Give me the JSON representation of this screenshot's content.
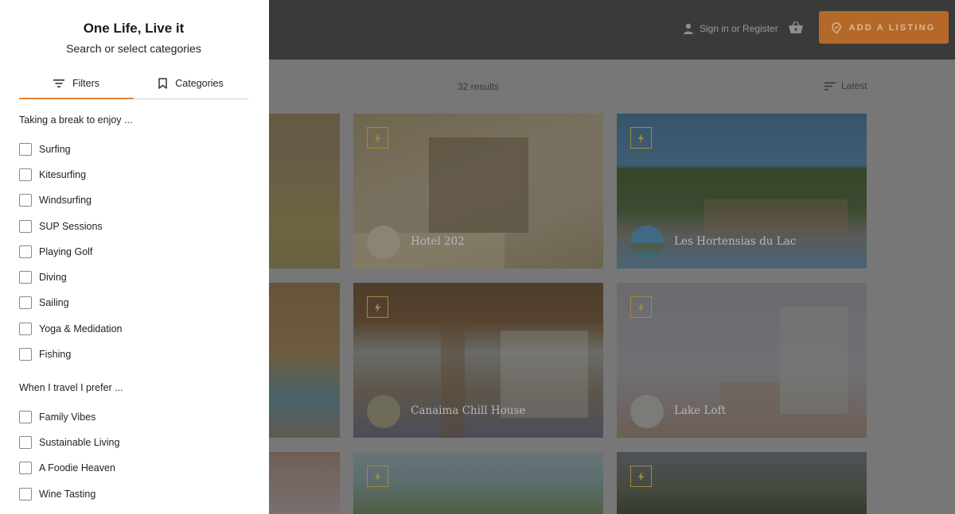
{
  "header": {
    "signin_label": "Sign in or Register",
    "add_listing_label": "ADD A LISTING"
  },
  "listing_bar": {
    "results_text": "32 results",
    "sort_label": "Latest"
  },
  "listings": [
    {
      "title": "Hotel 202"
    },
    {
      "title": "Les Hortensias du Lac"
    },
    {
      "title": "Canaima Chill House"
    },
    {
      "title": "Lake Loft"
    }
  ],
  "drawer": {
    "title": "One Life, Live it",
    "subtitle": "Search or select categories",
    "tabs": [
      {
        "label": "Filters",
        "icon": "filter-lines-icon",
        "active": true
      },
      {
        "label": "Categories",
        "icon": "bookmark-icon",
        "active": false
      }
    ],
    "sections": [
      {
        "title": "Taking a break to enjoy ...",
        "options": [
          "Surfing",
          "Kitesurfing",
          "Windsurfing",
          "SUP Sessions",
          "Playing Golf",
          "Diving",
          "Sailing",
          "Yoga & Medidation",
          "Fishing"
        ]
      },
      {
        "title": "When I travel I prefer ...",
        "options": [
          "Family Vibes",
          "Sustainable Living",
          "A Foodie Heaven",
          "Wine Tasting"
        ]
      }
    ]
  },
  "colors": {
    "accent": "#e8812f",
    "overlay": "#777777",
    "topbar": "#3a3a3a",
    "add_listing_button": "#b4692a"
  }
}
